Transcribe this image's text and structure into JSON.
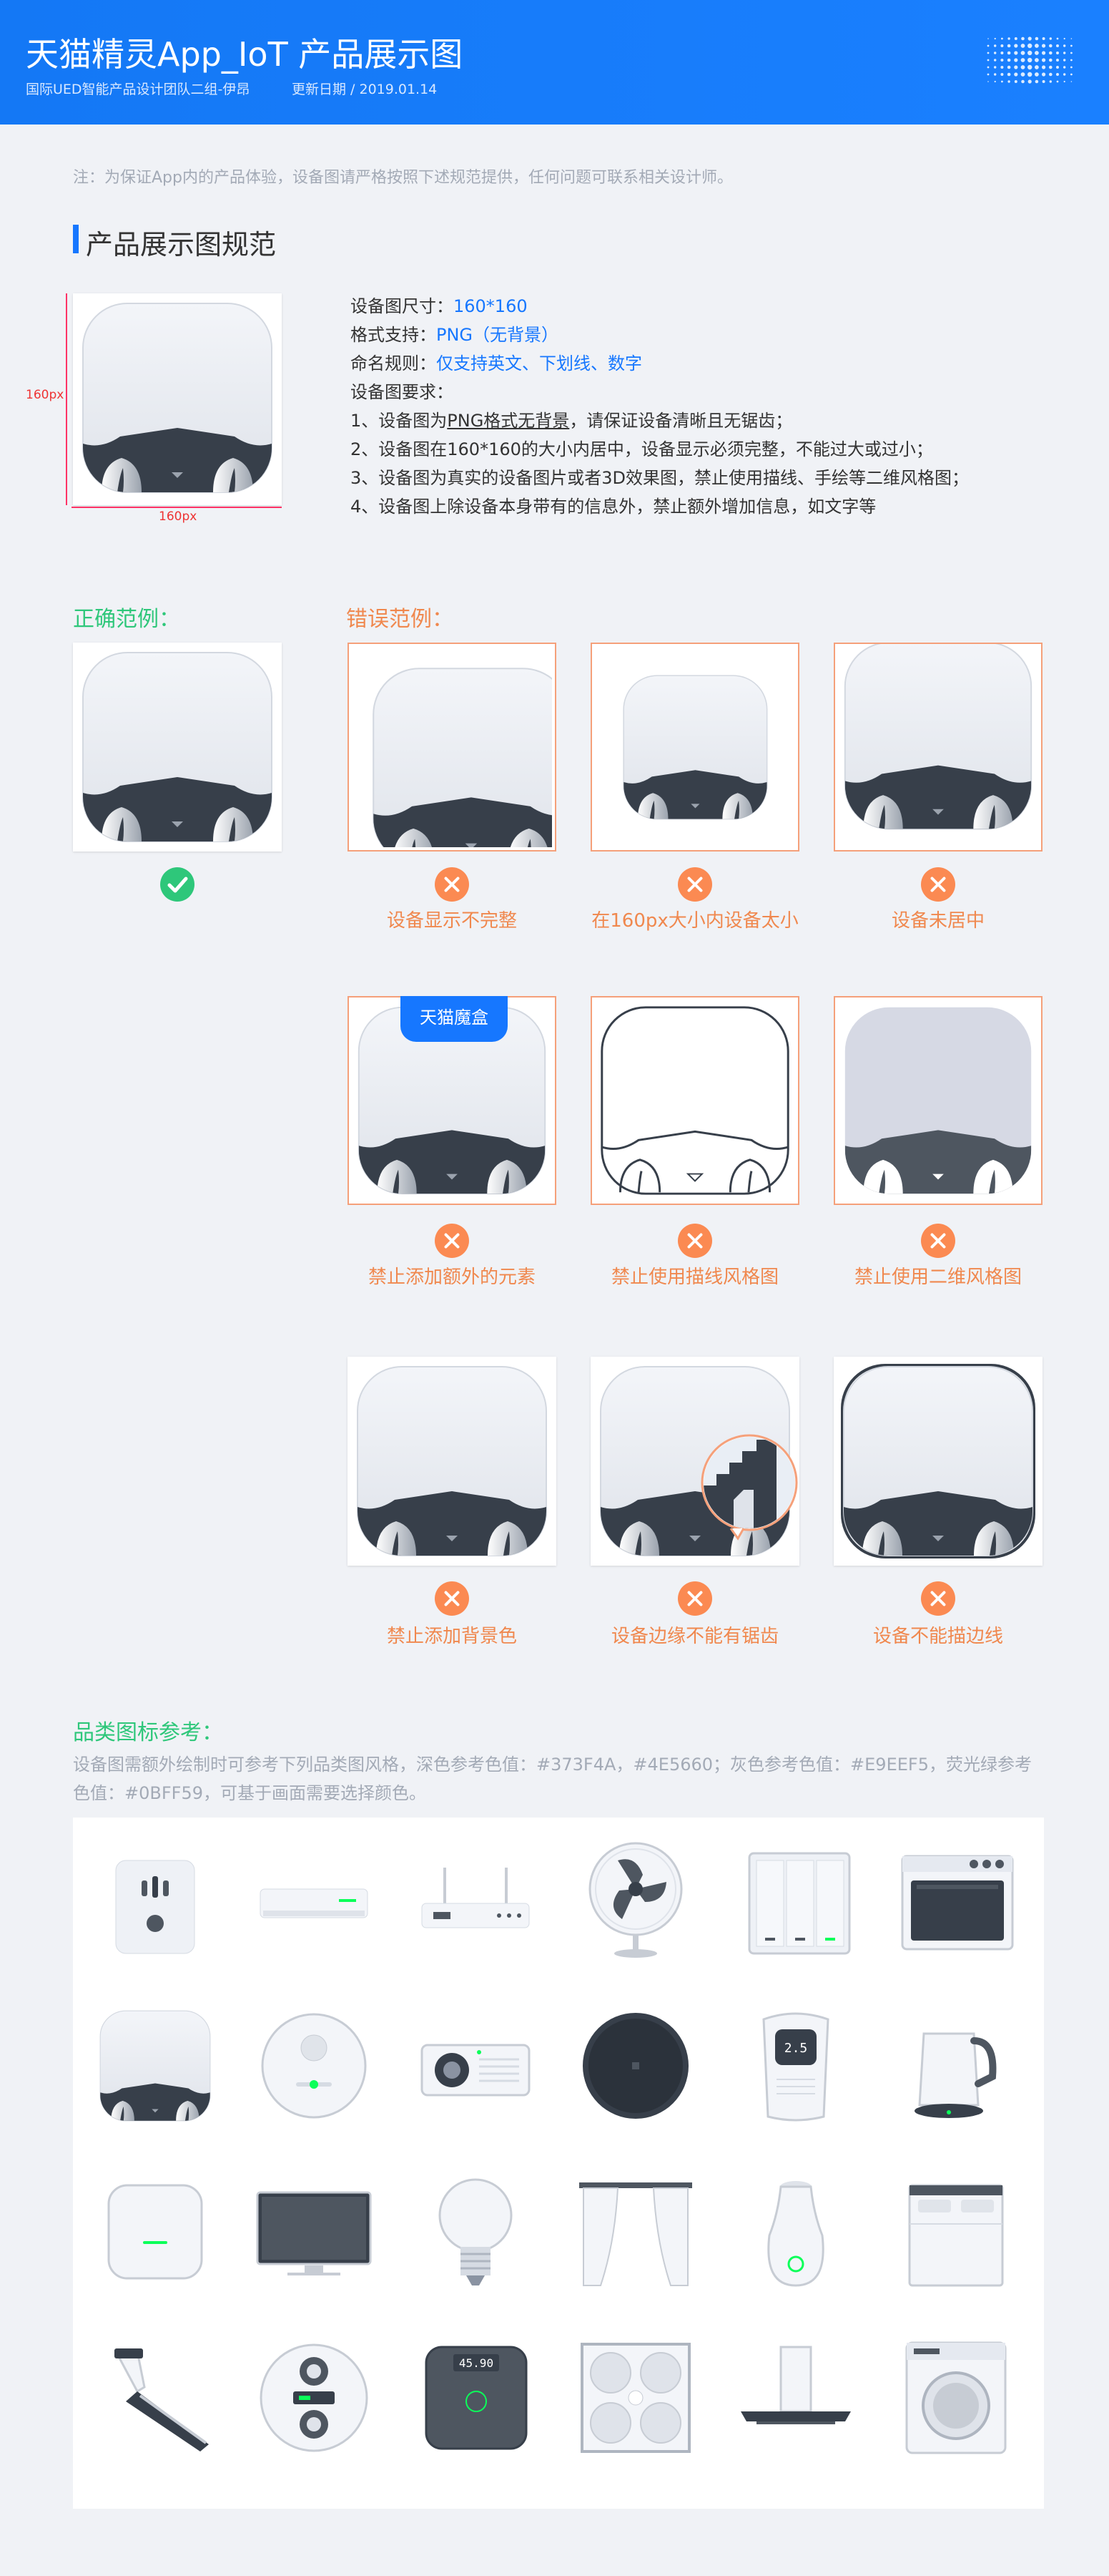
{
  "header": {
    "title": "天猫精灵App_IoT 产品展示图",
    "team": "国际UED智能产品设计团队二组-伊昂",
    "date": "更新日期 / 2019.01.14"
  },
  "note": "注：为保证App内的产品体验，设备图请严格按照下述规范提供，任何问题可联系相关设计师。",
  "section_title": "产品展示图规范",
  "dimension_label": "160px",
  "spec": {
    "size_label": "设备图尺寸：",
    "size_value": "160*160",
    "format_label": "格式支持：",
    "format_value": "PNG（无背景）",
    "naming_label": "命名规则：",
    "naming_value": "仅支持英文、下划线、数字",
    "req_label": "设备图要求：",
    "req1_prefix": "1、设备图为",
    "req1_highlight": "PNG格式无背景",
    "req1_suffix": "，请保证设备清晰且无锯齿；",
    "req2": "2、设备图在160*160的大小内居中，设备显示必须完整，不能过大或过小；",
    "req3": "3、设备图为真实的设备图片或者3D效果图，禁止使用描线、手绘等二维风格图；",
    "req4": "4、设备图上除设备本身带有的信息外，禁止额外增加信息，如文字等"
  },
  "correct_label": "正确范例：",
  "wrong_label": "错误范例：",
  "wrong_examples": [
    "设备显示不完整",
    "在160px大小内设备太小",
    "设备未居中",
    "禁止添加额外的元素",
    "禁止使用描线风格图",
    "禁止使用二维风格图",
    "禁止添加背景色",
    "设备边缘不能有锯齿",
    "设备不能描边线"
  ],
  "badge_text": "天猫魔盒",
  "category": {
    "title": "品类图标参考：",
    "desc": "设备图需额外绘制时可参考下列品类图风格，深色参考色值：#373F4A，#4E5660；灰色参考色值：#E9EEF5，荧光绿参考色值：#0BFF59，可基于画面需要选择颜色。",
    "scale_reading": "45.90",
    "purifier_reading": "2.5"
  },
  "colors": {
    "dark": "#373F4A",
    "dark2": "#4E5660",
    "gray": "#E9EEF5",
    "green": "#0BFF59",
    "brand": "#1677ff"
  }
}
